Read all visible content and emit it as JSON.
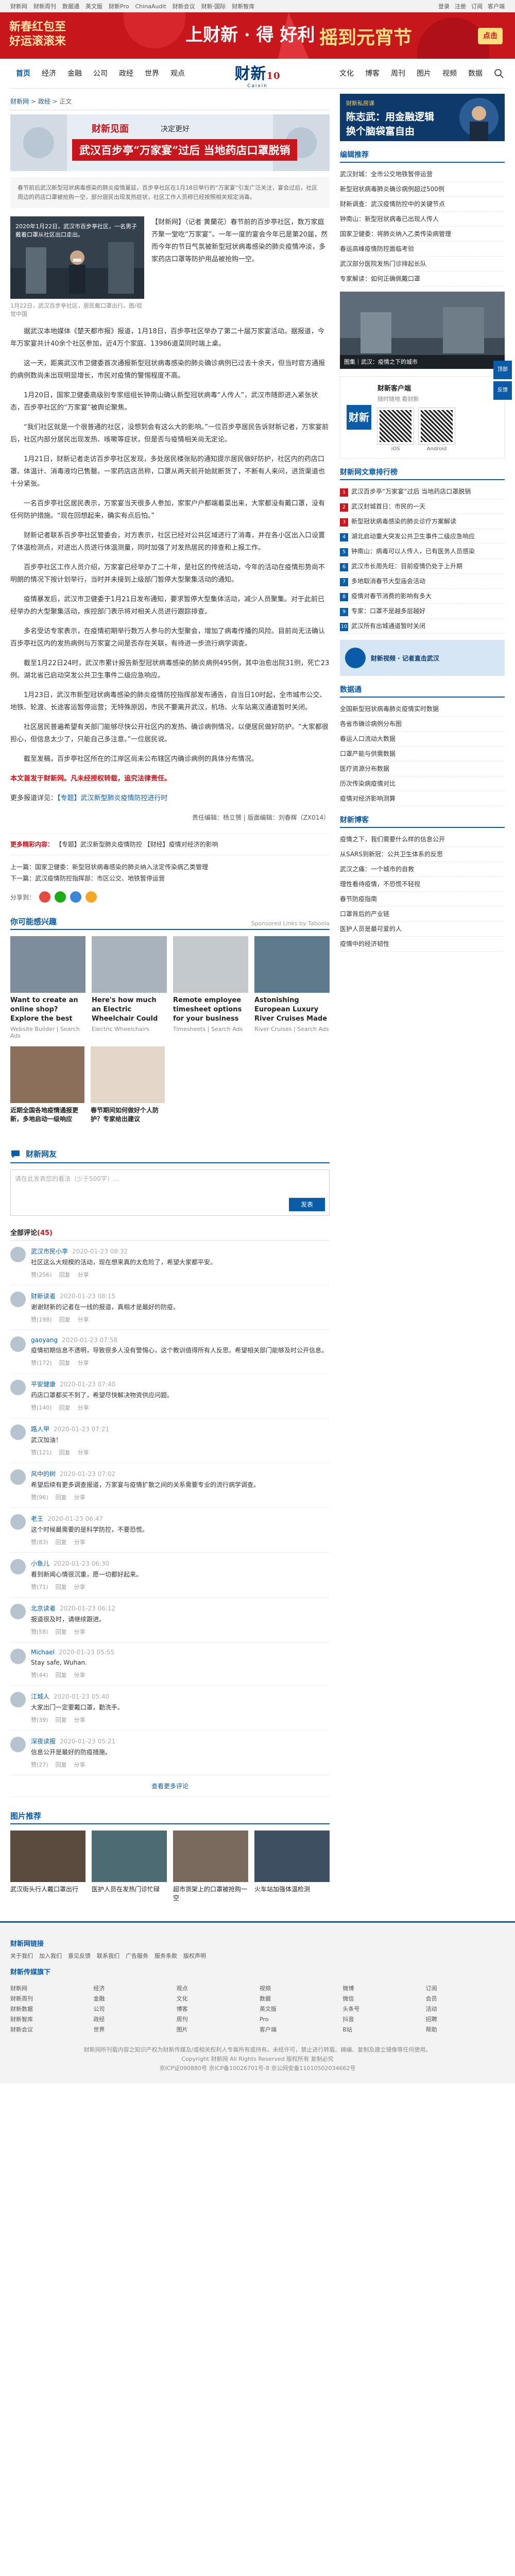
{
  "topbar": {
    "links": [
      "财新网",
      "财新周刊",
      "数据通",
      "英文版",
      "财新Pro",
      "ChinaAudit",
      "财新会议",
      "财新·国际",
      "财新智库"
    ],
    "right": [
      "登录",
      "注册",
      "订阅",
      "客户端"
    ]
  },
  "banner": {
    "left": "新春红包至\n好运滚滚来",
    "mid": "上财新 · 得 好利",
    "right": "摇到元宵节",
    "btn": "点击"
  },
  "nav": {
    "left": [
      "首页",
      "经济",
      "金融",
      "公司",
      "政经",
      "世界",
      "观点"
    ],
    "right": [
      "文化",
      "博客",
      "周刊",
      "图片",
      "视频",
      "数据"
    ],
    "logo_cn": "财新",
    "logo_en": "Caixin",
    "logo_badge": "10"
  },
  "crumb": [
    "财新网",
    "政经",
    "正文"
  ],
  "hero": {
    "brand": "财新见面",
    "slogan": "决定更好",
    "title": "武汉百步亭“万家宴”过后 当地药店口罩脱销"
  },
  "summary": "春节前后武汉新型冠状病毒感染的肺炎疫情蔓延，百步亭社区在1月18日举行的“万家宴”引发广泛关注，宴会过后，社区周边的药店口罩被抢购一空，部分居民出现发热症状，社区工作人员称已经按照相关规定消毒。",
  "photo": {
    "overlay": "2020年1月22日，武汉市百步亭社区，一名男子戴着口罩从社区出口走出。",
    "caption": "1月22日，武汉百步亭社区，居民戴口罩出行。图/视觉中国"
  },
  "lead": "【财新网】（记者 黄蘭花）春节前的百步亭社区，数万家庭齐聚一堂吃“万家宴”。一年一度的宴会今年已是第20届，然而今年的节日气氛被新型冠状病毒感染的肺炎疫情冲淡，多家药店口罩等防护用品被抢购一空。",
  "article": [
    "据武汉本地媒体《楚天都市报》报道，1月18日，百步亭社区举办了第二十届万家宴活动。据报道，今年万家宴共计40余个社区参加，近4万个家庭、13986道菜同时端上桌。",
    "这一天，距离武汉市卫健委首次通报新型冠状病毒感染的肺炎确诊病例已过去十余天，但当时官方通报的病例数尚未出现明显增长，市民对疫情的警惕程度不高。",
    "1月20日，国家卫健委高级别专家组组长钟南山确认新型冠状病毒“人传人”，武汉市随即进入紧张状态，百步亭社区的“万家宴”被舆论聚焦。",
    "“我们社区就是一个很普通的社区，没想到会有这么大的影响。”一位百步亭居民告诉财新记者，万家宴前后，社区内部分居民出现发热、咳嗽等症状，但是否与疫情相关尚无定论。",
    "1月21日，财新记者走访百步亭社区发现，多处居民楼张贴的通知提示居民做好防护，社区内的药店口罩、体温计、消毒液均已售罄。一家药店店员称，口罩从两天前开始就断货了，不断有人来问，进货渠道也十分紧张。",
    "一名百步亭社区居民表示，万家宴当天很多人参加，家家户户都端着菜出来，大家都没有戴口罩，没有任何防护措施。“现在回想起来，确实有点后怕。”",
    "财新记者联系百步亭社区管委会，对方表示，社区已经对公共区域进行了消毒，并在各小区出入口设置了体温检测点，对进出人员进行体温测量，同时加强了对发热居民的排查和上报工作。",
    "百步亭社区工作人员介绍，万家宴已经举办了二十年，是社区的传统活动，今年的活动在疫情形势尚不明朗的情况下按计划举行，当时并未接到上级部门暂停大型聚集活动的通知。",
    "疫情暴发后，武汉市卫健委于1月21日发布通知，要求暂停大型集体活动，减少人员聚集。对于此前已经举办的大型聚集活动，疾控部门表示将对相关人员进行跟踪排查。",
    "多名受访专家表示，在疫情初期举行数万人参与的大型聚会，增加了病毒传播的风险。目前尚无法确认百步亭社区内的发热病例与万家宴之间是否存在关联，有待进一步流行病学调查。",
    "截至1月22日24时，武汉市累计报告新型冠状病毒感染的肺炎病例495例，其中治愈出院31例，死亡23例。湖北省已启动突发公共卫生事件二级应急响应。",
    "1月23日，武汉市新型冠状病毒感染的肺炎疫情防控指挥部发布通告，自当日10时起，全市城市公交、地铁、轮渡、长途客运暂停运营；无特殊原因，市民不要离开武汉，机场、火车站离汉通道暂时关闭。",
    "社区居民普遍希望有关部门能够尽快公开社区内的发热、确诊病例情况，以便居民做好防护。“大家都很担心，但信息太少了，只能自己多注意。”一位居民说。",
    "截至发稿，百步亭社区所在的江岸区尚未公布辖区内确诊病例的具体分布情况。"
  ],
  "source_note": "本文首发于财新网。凡未经授权转载，追究法律责任。",
  "more_note": "更多报道详见：",
  "more_link": "【专题】武汉新型肺炎疫情防控进行时",
  "editor": "责任编辑：杨立赟 | 版面编辑：刘春辉（ZX014）",
  "ad_line": {
    "tag": "更多精彩内容：",
    "text": "【专题】武汉新型肺炎疫情防控 【财经】疫情对经济的影响"
  },
  "prevnext": [
    "上一篇：国家卫健委：新型冠状病毒感染的肺炎纳入法定传染病乙类管理",
    "下一篇：武汉疫情防控指挥部：市区公交、地铁暂停运营"
  ],
  "share": {
    "label": "分享到：",
    "colors": [
      "#e24b3e",
      "#1aad19",
      "#3b86d9",
      "#f5a623"
    ]
  },
  "recommend": {
    "title": "你可能感兴趣",
    "tag": "Sponsored Links by Taboola",
    "cards": [
      {
        "t": "Want to create an online shop? Explore the best web builders",
        "s": "Website Builder | Search Ads",
        "c": "#7d8d9c"
      },
      {
        "t": "Here's how much an Electric Wheelchair Could Cost You",
        "s": "Electric Wheelchairs",
        "c": "#a8b3bd"
      },
      {
        "t": "Remote employee timesheet options for your business",
        "s": "Timesheets | Search Ads",
        "c": "#c4c9cd"
      },
      {
        "t": "Astonishing European Luxury River Cruises Made Affordable With...",
        "s": "River Cruises | Search Ads",
        "c": "#5f7a8c"
      }
    ],
    "cards2": [
      {
        "t": "近期全国各地疫情通报更新，多地启动一级响应",
        "c": "#8b6f5a"
      },
      {
        "t": "春节期间如何做好个人防护？专家给出建议",
        "c": "#e4d6c8"
      }
    ]
  },
  "comments": {
    "title": "财新网友",
    "placeholder": "请在此发表您的看法（少于500字）...",
    "submit": "发表",
    "count_label": "全部评论",
    "count": "(45)",
    "items": [
      {
        "who": "武汉市民小李",
        "tm": "2020-01-23 08:32",
        "txt": "社区这么大规模的活动，现在想来真的太危险了，希望大家都平安。",
        "likes": "赞(256)"
      },
      {
        "who": "财新读者",
        "tm": "2020-01-23 08:15",
        "txt": "谢谢财新的记者在一线的报道，真相才是最好的防疫。",
        "likes": "赞(198)"
      },
      {
        "who": "gaoyang",
        "tm": "2020-01-23 07:58",
        "txt": "疫情初期信息不透明，导致很多人没有警惕心，这个教训值得所有人反思。希望相关部门能够及时公开信息。",
        "likes": "赞(172)"
      },
      {
        "who": "平安健康",
        "tm": "2020-01-23 07:40",
        "txt": "药店口罩都买不到了，希望尽快解决物资供应问题。",
        "likes": "赞(140)"
      },
      {
        "who": "路人甲",
        "tm": "2020-01-23 07:21",
        "txt": "武汉加油！",
        "likes": "赞(121)"
      },
      {
        "who": "风中的树",
        "tm": "2020-01-23 07:02",
        "txt": "希望后续有更多调查报道，万家宴与疫情扩散之间的关系需要专业的流行病学调查。",
        "likes": "赞(96)"
      },
      {
        "who": "老王",
        "tm": "2020-01-23 06:47",
        "txt": "这个时候最需要的是科学防控，不要恐慌。",
        "likes": "赞(83)"
      },
      {
        "who": "小鱼儿",
        "tm": "2020-01-23 06:30",
        "txt": "看到新闻心情很沉重，愿一切都好起来。",
        "likes": "赞(71)"
      },
      {
        "who": "北京读者",
        "tm": "2020-01-23 06:12",
        "txt": "报道很及时，请继续跟进。",
        "likes": "赞(58)"
      },
      {
        "who": "Michael",
        "tm": "2020-01-23 05:55",
        "txt": "Stay safe, Wuhan.",
        "likes": "赞(44)"
      },
      {
        "who": "江城人",
        "tm": "2020-01-23 05:40",
        "txt": "大家出门一定要戴口罩，勤洗手。",
        "likes": "赞(39)"
      },
      {
        "who": "深夜读报",
        "tm": "2020-01-23 05:21",
        "txt": "信息公开是最好的防疫措施。",
        "likes": "赞(27)"
      }
    ],
    "ops": [
      "回复",
      "分享"
    ],
    "more": "查看更多评论"
  },
  "photo_sec": {
    "title": "图片推荐",
    "items": [
      {
        "t": "武汉街头行人戴口罩出行",
        "c": "#5b4a3e"
      },
      {
        "t": "医护人员在发热门诊忙碌",
        "c": "#4c6b72"
      },
      {
        "t": "超市货架上的口罩被抢购一空",
        "c": "#7a6a5d"
      },
      {
        "t": "火车站加强体温检测",
        "c": "#3f4f62"
      }
    ]
  },
  "side": {
    "ad": {
      "a1": "财新私房课",
      "a2": "陈志武：用金融逻辑",
      "a3": "换个脑袋富自由"
    },
    "s1_title": "编辑推荐",
    "s1_items": [
      "武汉封城：全市公交地铁暂停运营",
      "新型冠状病毒肺炎确诊病例超过500例",
      "财新调查：武汉疫情防控中的关键节点",
      "钟南山：新型冠状病毒已出现人传人",
      "国家卫健委：将肺炎纳入乙类传染病管理",
      "春运高峰疫情防控面临考验",
      "武汉部分医院发热门诊排起长队",
      "专家解读：如何正确佩戴口罩"
    ],
    "side_img_cap": "图集｜武汉：疫情之下的城市",
    "app_t1": "财新客户端",
    "app_t2": "随时随地 看财新",
    "qr1": "iOS",
    "qr2": "Android",
    "rank_title": "财新网文章排行榜",
    "rank_items": [
      "武汉百步亭“万家宴”过后 当地药店口罩脱销",
      "武汉封城首日：市民的一天",
      "新型冠状病毒感染的肺炎诊疗方案解读",
      "湖北启动重大突发公共卫生事件二级应急响应",
      "钟南山：病毒可以人传人，已有医务人员感染",
      "武汉市长周先旺：目前疫情仍处于上升期",
      "多地取消春节大型庙会活动",
      "疫情对春节消费的影响有多大",
      "专家：口罩不是越多层越好",
      "武汉所有出城通道暂时关闭"
    ],
    "vid_t": "财新视频 · 记者直击武汉",
    "dt_title": "数据通",
    "dt_items": [
      "全国新型冠状病毒肺炎疫情实时数据",
      "各省市确诊病例分布图",
      "春运人口流动大数据",
      "口罩产能与供需数据",
      "医疗资源分布数据",
      "历次传染病疫情对比",
      "疫情对经济影响测算"
    ],
    "blog_title": "财新博客",
    "blog_items": [
      "疫情之下，我们需要什么样的信息公开",
      "从SARS到新冠：公共卫生体系的反思",
      "武汉之痛：一个城市的自救",
      "理性看待疫情，不恐慌不轻视",
      "春节防疫指南",
      "口罩背后的产业链",
      "医护人员是最可爱的人",
      "疫情中的经济韧性"
    ]
  },
  "footer": {
    "h1": "财新网链接",
    "links1": [
      "关于我们",
      "加入我们",
      "意见反馈",
      "联系我们",
      "广告服务",
      "服务条款",
      "版权声明"
    ],
    "h2": "财新传媒旗下",
    "cols": [
      [
        "财新网",
        "财新周刊",
        "财新数据",
        "财新智库",
        "财新会议"
      ],
      [
        "经济",
        "金融",
        "公司",
        "政经",
        "世界"
      ],
      [
        "观点",
        "文化",
        "博客",
        "周刊",
        "图片"
      ],
      [
        "视频",
        "数据",
        "英文版",
        "Pro",
        "客户端"
      ],
      [
        "微博",
        "微信",
        "头条号",
        "抖音",
        "B站"
      ],
      [
        "订阅",
        "会员",
        "活动",
        "招聘",
        "帮助"
      ]
    ],
    "copy1": "财新网所刊载内容之知识产权为财新传媒及/或相关权利人专属所有或持有。未经许可，禁止进行转载、摘编、复制及建立镜像等任何使用。",
    "copy2": "Copyright 财新网 All Rights Reserved 版权所有 复制必究",
    "copy3": "京ICP证090880号 京ICP备10026701号-8 京公网安备11010502034662号"
  },
  "float": [
    "顶部",
    "反馈"
  ]
}
